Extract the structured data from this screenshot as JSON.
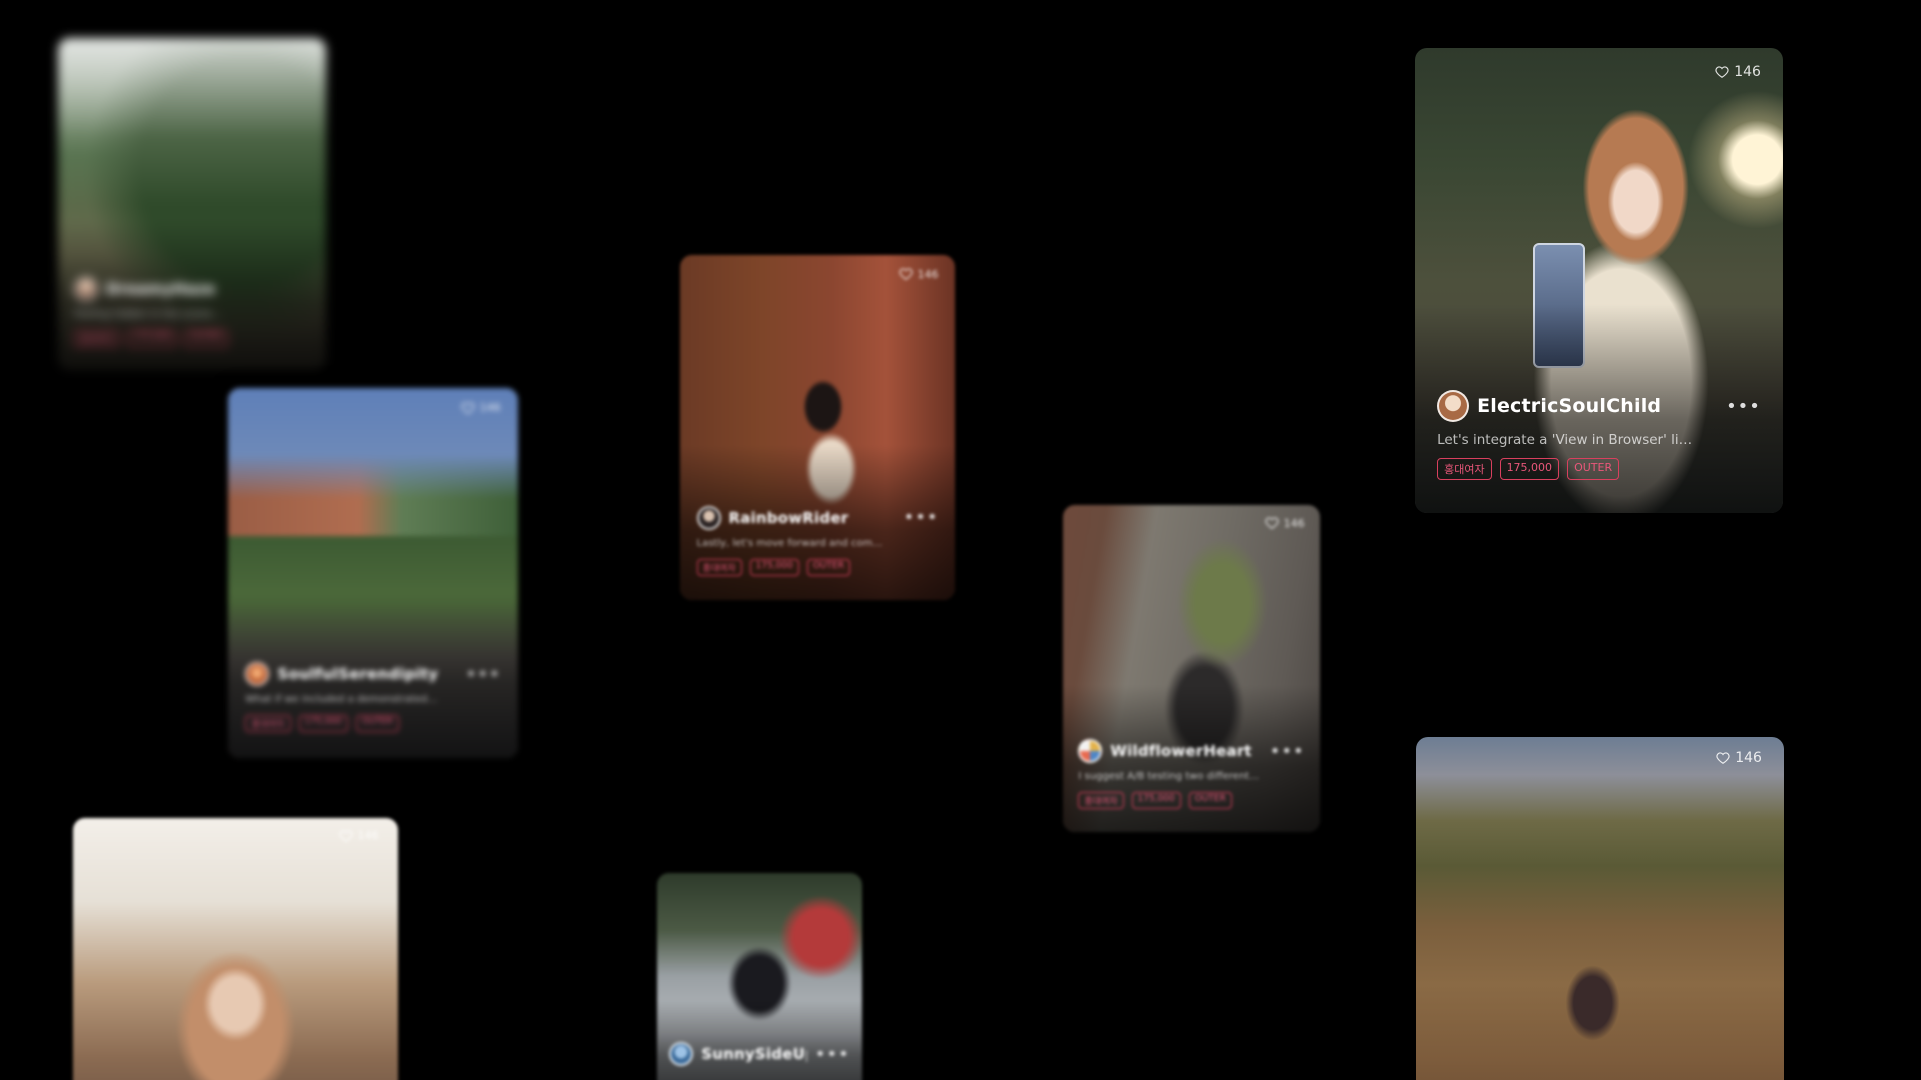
{
  "feed": {
    "cards": [
      {
        "id": "c1",
        "username": "DreamyHaze",
        "description": "Feeling hidden in the scene…",
        "likes": "",
        "tags": [
          "홍대여자",
          "175,000",
          "OUTER"
        ]
      },
      {
        "id": "c2",
        "username": "SoulfulSerendipity",
        "description": "What if we included a demonstrated…",
        "likes": "146",
        "tags": [
          "홍대여자",
          "175,000",
          "OUTER"
        ]
      },
      {
        "id": "c3",
        "username": "RainbowRider",
        "description": "Lastly, let's move forward and com…",
        "likes": "146",
        "tags": [
          "홍대여자",
          "175,000",
          "OUTER"
        ]
      },
      {
        "id": "c4",
        "username": "WildflowerHeart",
        "description": "I suggest A/B testing two different…",
        "likes": "146",
        "tags": [
          "홍대여자",
          "175,000",
          "OUTER"
        ]
      },
      {
        "id": "c5",
        "username": "ElectricSoulChild",
        "description": "Let's integrate a 'View in Browser' li…",
        "likes": "146",
        "tags": [
          "홍대여자",
          "175,000",
          "OUTER"
        ]
      },
      {
        "id": "c6",
        "username": "",
        "description": "",
        "likes": "146",
        "tags": []
      },
      {
        "id": "c7",
        "username": "SunnySideUp",
        "description": "",
        "likes": "",
        "tags": []
      },
      {
        "id": "c8",
        "username": "",
        "description": "",
        "likes": "146",
        "tags": []
      }
    ]
  },
  "icons": {
    "like": "heart-outline-icon",
    "more": "more-horizontal-icon"
  },
  "colors": {
    "background": "#000000",
    "tag_accent": "#d8405e"
  }
}
